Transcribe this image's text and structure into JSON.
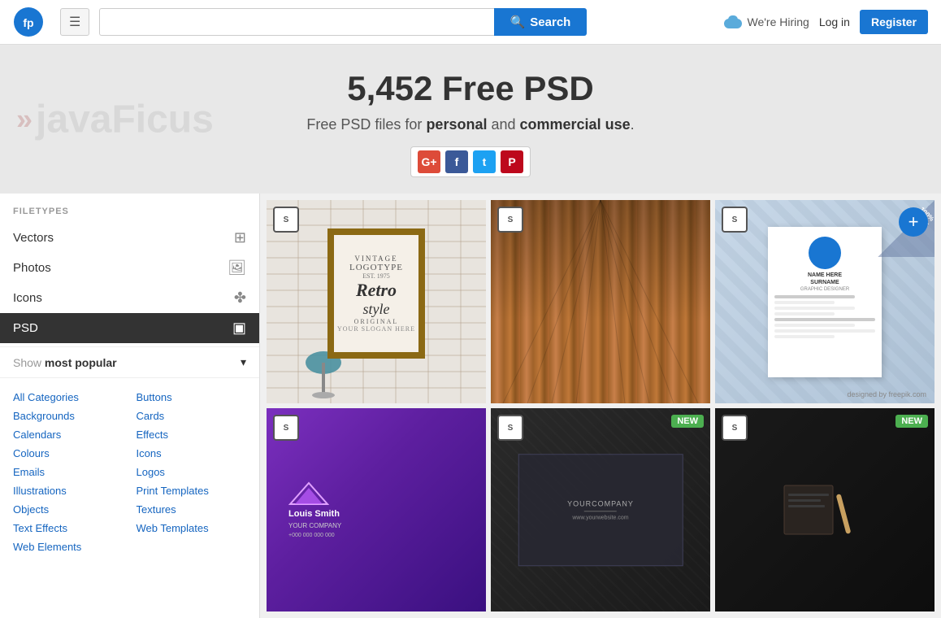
{
  "header": {
    "logo_alt": "Freepik",
    "hamburger_label": "☰",
    "search_placeholder": "",
    "search_button_label": "Search",
    "search_icon": "🔍",
    "hiring_label": "We're Hiring",
    "login_label": "Log in",
    "register_label": "Register"
  },
  "hero": {
    "watermark_arrows": "»",
    "watermark_text": "javaFicus",
    "title": "5,452 Free PSD",
    "subtitle_start": "Free PSD files for ",
    "subtitle_personal": "personal",
    "subtitle_middle": " and ",
    "subtitle_commercial": "commercial use",
    "subtitle_end": ".",
    "social_icons": [
      {
        "name": "google-plus-icon",
        "label": "G+"
      },
      {
        "name": "facebook-icon",
        "label": "f"
      },
      {
        "name": "twitter-icon",
        "label": "t"
      },
      {
        "name": "pinterest-icon",
        "label": "P"
      }
    ]
  },
  "sidebar": {
    "filetypes_title": "FILETYPES",
    "filetypes": [
      {
        "label": "Vectors",
        "icon": "⊞"
      },
      {
        "label": "Photos",
        "icon": "🖼"
      },
      {
        "label": "Icons",
        "icon": "✤"
      },
      {
        "label": "PSD",
        "icon": "▣",
        "active": true
      }
    ],
    "show_popular_label": "Show",
    "most_popular_label": "most popular",
    "dropdown_icon": "▾",
    "categories": [
      {
        "label": "All Categories",
        "col": 1
      },
      {
        "label": "Backgrounds",
        "col": 1
      },
      {
        "label": "Calendars",
        "col": 1
      },
      {
        "label": "Colours",
        "col": 1
      },
      {
        "label": "Emails",
        "col": 1
      },
      {
        "label": "Illustrations",
        "col": 1
      },
      {
        "label": "Objects",
        "col": 1
      },
      {
        "label": "Text Effects",
        "col": 1
      },
      {
        "label": "Web Elements",
        "col": 1
      },
      {
        "label": "Buttons",
        "col": 2
      },
      {
        "label": "Cards",
        "col": 2
      },
      {
        "label": "Effects",
        "col": 2
      },
      {
        "label": "Icons",
        "col": 2
      },
      {
        "label": "Logos",
        "col": 2
      },
      {
        "label": "Print Templates",
        "col": 2
      },
      {
        "label": "Textures",
        "col": 2
      },
      {
        "label": "Web Templates",
        "col": 2
      }
    ]
  },
  "content": {
    "thumbnails": [
      {
        "id": 1,
        "type": "retro",
        "badge": "S",
        "new": false
      },
      {
        "id": 2,
        "type": "wood",
        "badge": "S",
        "new": false
      },
      {
        "id": 3,
        "type": "resume",
        "badge": "S",
        "new": false
      },
      {
        "id": 4,
        "type": "purple",
        "badge": "S",
        "new": false
      },
      {
        "id": 5,
        "type": "dark",
        "badge": "S",
        "new": true
      },
      {
        "id": 6,
        "type": "darker",
        "badge": "S",
        "new": true
      }
    ]
  },
  "add_button_label": "+"
}
